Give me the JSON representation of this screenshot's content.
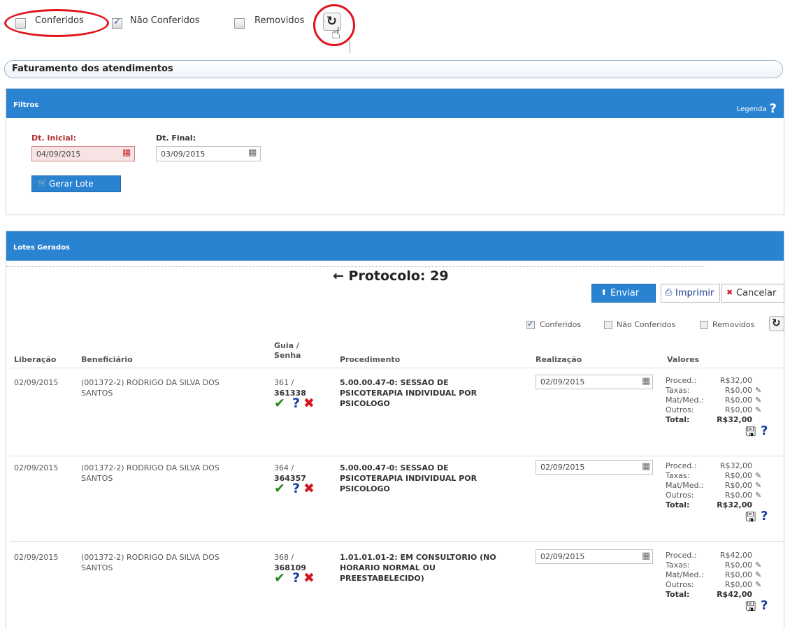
{
  "top_filters": {
    "conferidos": "Conferidos",
    "nao_conferidos": "Não Conferidos",
    "removidos": "Removidos",
    "conferidos_checked": false,
    "nao_conferidos_checked": true,
    "removidos_checked": false
  },
  "page_title": "Faturamento dos atendimentos",
  "filtros": {
    "title": "Filtros",
    "legenda": "Legenda",
    "dt_inicial_label": "Dt. Inicial:",
    "dt_inicial_value": "04/09/2015",
    "dt_final_label": "Dt. Final:",
    "dt_final_value": "03/09/2015",
    "gerar_lote": "Gerar Lote"
  },
  "lotes": {
    "title": "Lotes Gerados",
    "protocolo": "← Protocolo: 29",
    "enviar": "Enviar",
    "imprimir": "Imprimir",
    "cancelar": "Cancelar",
    "filters": {
      "conferidos": "Conferidos",
      "nao_conferidos": "Não Conferidos",
      "removidos": "Removidos"
    }
  },
  "table": {
    "headers": {
      "liberacao": "Liberação",
      "beneficiario": "Beneficiário",
      "guia_line1": "Guia /",
      "guia_line2": "Senha",
      "procedimento": "Procedimento",
      "realizacao": "Realização",
      "valores": "Valores"
    },
    "value_labels": {
      "proced": "Proced.:",
      "taxas": "Taxas:",
      "matmed": "Mat/Med.:",
      "outros": "Outros:",
      "total": "Total:"
    },
    "rows": [
      {
        "liberacao": "02/09/2015",
        "beneficiario_1": "(001372-2) RODRIGO DA SILVA DOS",
        "beneficiario_2": "SANTOS",
        "guia": "361 /",
        "senha": "361338",
        "proc_1": "5.00.00.47-0: SESSAO DE",
        "proc_2": "PSICOTERAPIA INDIVIDUAL POR",
        "proc_3": "PSICOLOGO",
        "realizacao": "02/09/2015",
        "proced": "R$32,00",
        "taxas": "R$0,00",
        "matmed": "R$0,00",
        "outros": "R$0,00",
        "total": "R$32,00"
      },
      {
        "liberacao": "02/09/2015",
        "beneficiario_1": "(001372-2) RODRIGO DA SILVA DOS",
        "beneficiario_2": "SANTOS",
        "guia": "364 /",
        "senha": "364357",
        "proc_1": "5.00.00.47-0: SESSAO DE",
        "proc_2": "PSICOTERAPIA INDIVIDUAL POR",
        "proc_3": "PSICOLOGO",
        "realizacao": "02/09/2015",
        "proced": "R$32,00",
        "taxas": "R$0,00",
        "matmed": "R$0,00",
        "outros": "R$0,00",
        "total": "R$32,00"
      },
      {
        "liberacao": "02/09/2015",
        "beneficiario_1": "(001372-2) RODRIGO DA SILVA DOS",
        "beneficiario_2": "SANTOS",
        "guia": "368 /",
        "senha": "368109",
        "proc_1": "1.01.01.01-2: EM CONSULTORIO (NO",
        "proc_2": "HORARIO NORMAL OU",
        "proc_3": "PREESTABELECIDO)",
        "realizacao": "02/09/2015",
        "proced": "R$42,00",
        "taxas": "R$0,00",
        "matmed": "R$0,00",
        "outros": "R$0,00",
        "total": "R$42,00"
      }
    ]
  },
  "icons": {
    "check": "✔",
    "help": "?",
    "remove": "✖",
    "calendar": "▦",
    "edit": "✎",
    "save": "🖫",
    "refresh": "↻",
    "upload": "⬆",
    "print": "⎙",
    "cart": "🛒",
    "hand": "☝"
  },
  "colors": {
    "panel_blue": "#2a83d1",
    "annotation_red": "#e0141d",
    "check_green": "#2a8a20",
    "help_blue": "#1a3fa4"
  }
}
